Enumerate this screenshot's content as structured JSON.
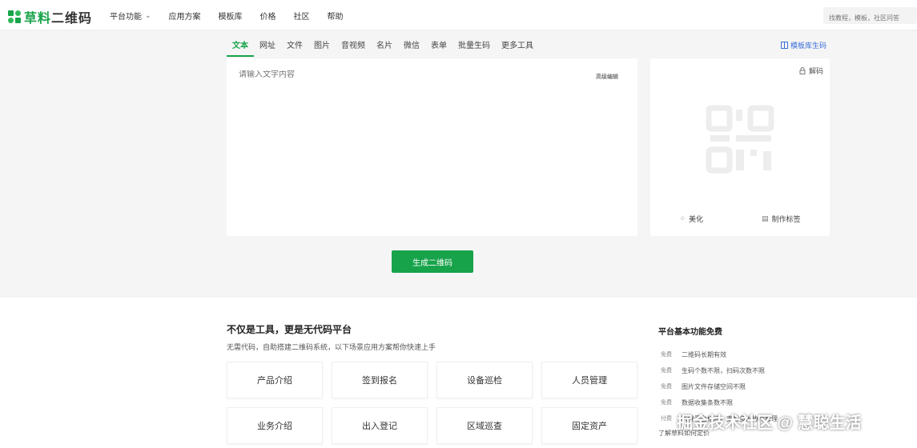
{
  "header": {
    "logo_brand": "草料",
    "logo_rest": "二维码",
    "nav": [
      {
        "label": "平台功能",
        "has_dropdown": true
      },
      {
        "label": "应用方案"
      },
      {
        "label": "模板库"
      },
      {
        "label": "价格"
      },
      {
        "label": "社区"
      },
      {
        "label": "帮助"
      }
    ],
    "search_placeholder": "找教程，模板，社区问答"
  },
  "tabs": [
    "文本",
    "网址",
    "文件",
    "图片",
    "音视频",
    "名片",
    "微信",
    "表单",
    "批量生码",
    "更多工具"
  ],
  "active_tab": "文本",
  "template_link": "模板库生码",
  "editor": {
    "placeholder": "请输入文字内容",
    "advanced_label": "高级编辑"
  },
  "qr_panel": {
    "decode_label": "解码",
    "beautify_label": "美化",
    "label_maker": "制作标签"
  },
  "generate_button": "生成二维码",
  "platform": {
    "title": "不仅是工具，更是无代码平台",
    "subtitle": "无需代码，自助搭建二维码系统，以下场景应用方案帮你快速上手",
    "cards": [
      "产品介绍",
      "签到报名",
      "设备巡检",
      "人员管理",
      "业务介绍",
      "出入登记",
      "区域巡查",
      "固定资产"
    ]
  },
  "features": {
    "title": "平台基本功能免费",
    "items": [
      {
        "tag": "免费",
        "text": "二维码长期有效"
      },
      {
        "tag": "免费",
        "text": "生码个数不限，扫码次数不限"
      },
      {
        "tag": "免费",
        "text": "图片文件存储空间不限"
      },
      {
        "tag": "免费",
        "text": "数据收集条数不限"
      },
      {
        "tag": "付费",
        "text": "去除平台标识，支持多人协作管理"
      }
    ],
    "more": "了解草料如何定价"
  },
  "watermark": "掘金技术社区 @ 慧聪生活",
  "colors": {
    "accent": "#17a34a",
    "link": "#3b6fd9"
  }
}
